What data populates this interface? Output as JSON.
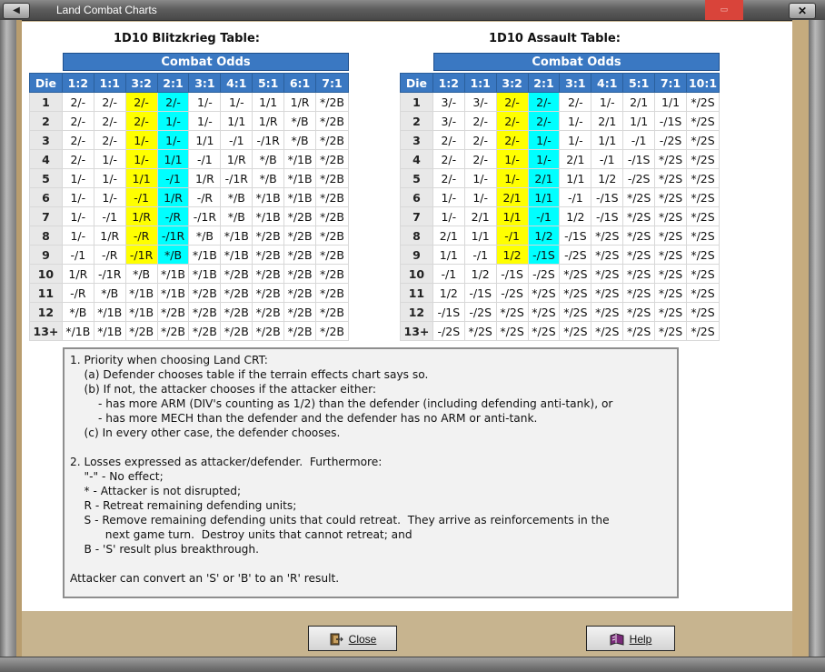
{
  "window": {
    "title": "Land Combat Charts",
    "left_icon": "◀",
    "minimize_icon": "▭",
    "close_icon": "✕"
  },
  "blitzkrieg": {
    "title": "1D10 Blitzkrieg Table:",
    "odds_banner": "Combat Odds",
    "headers": [
      "Die",
      "1:2",
      "1:1",
      "3:2",
      "2:1",
      "3:1",
      "4:1",
      "5:1",
      "6:1",
      "7:1"
    ],
    "rows": [
      [
        "1",
        "2/-",
        "2/-",
        "2/-",
        "2/-",
        "1/-",
        "1/-",
        "1/1",
        "1/R",
        "*/2B"
      ],
      [
        "2",
        "2/-",
        "2/-",
        "2/-",
        "1/-",
        "1/-",
        "1/1",
        "1/R",
        "*/B",
        "*/2B"
      ],
      [
        "3",
        "2/-",
        "2/-",
        "1/-",
        "1/-",
        "1/1",
        "-/1",
        "-/1R",
        "*/B",
        "*/2B"
      ],
      [
        "4",
        "2/-",
        "1/-",
        "1/-",
        "1/1",
        "-/1",
        "1/R",
        "*/B",
        "*/1B",
        "*/2B"
      ],
      [
        "5",
        "1/-",
        "1/-",
        "1/1",
        "-/1",
        "1/R",
        "-/1R",
        "*/B",
        "*/1B",
        "*/2B"
      ],
      [
        "6",
        "1/-",
        "1/-",
        "-/1",
        "1/R",
        "-/R",
        "*/B",
        "*/1B",
        "*/1B",
        "*/2B"
      ],
      [
        "7",
        "1/-",
        "-/1",
        "1/R",
        "-/R",
        "-/1R",
        "*/B",
        "*/1B",
        "*/2B",
        "*/2B"
      ],
      [
        "8",
        "1/-",
        "1/R",
        "-/R",
        "-/1R",
        "*/B",
        "*/1B",
        "*/2B",
        "*/2B",
        "*/2B"
      ],
      [
        "9",
        "-/1",
        "-/R",
        "-/1R",
        "*/B",
        "*/1B",
        "*/1B",
        "*/2B",
        "*/2B",
        "*/2B"
      ],
      [
        "10",
        "1/R",
        "-/1R",
        "*/B",
        "*/1B",
        "*/1B",
        "*/2B",
        "*/2B",
        "*/2B",
        "*/2B"
      ],
      [
        "11",
        "-/R",
        "*/B",
        "*/1B",
        "*/1B",
        "*/2B",
        "*/2B",
        "*/2B",
        "*/2B",
        "*/2B"
      ],
      [
        "12",
        "*/B",
        "*/1B",
        "*/1B",
        "*/2B",
        "*/2B",
        "*/2B",
        "*/2B",
        "*/2B",
        "*/2B"
      ],
      [
        "13+",
        "*/1B",
        "*/1B",
        "*/2B",
        "*/2B",
        "*/2B",
        "*/2B",
        "*/2B",
        "*/2B",
        "*/2B"
      ]
    ]
  },
  "assault": {
    "title": "1D10 Assault Table:",
    "odds_banner": "Combat Odds",
    "headers": [
      "Die",
      "1:2",
      "1:1",
      "3:2",
      "2:1",
      "3:1",
      "4:1",
      "5:1",
      "7:1",
      "10:1"
    ],
    "rows": [
      [
        "1",
        "3/-",
        "3/-",
        "2/-",
        "2/-",
        "2/-",
        "1/-",
        "2/1",
        "1/1",
        "*/2S"
      ],
      [
        "2",
        "3/-",
        "2/-",
        "2/-",
        "2/-",
        "1/-",
        "2/1",
        "1/1",
        "-/1S",
        "*/2S"
      ],
      [
        "3",
        "2/-",
        "2/-",
        "2/-",
        "1/-",
        "1/-",
        "1/1",
        "-/1",
        "-/2S",
        "*/2S"
      ],
      [
        "4",
        "2/-",
        "2/-",
        "1/-",
        "1/-",
        "2/1",
        "-/1",
        "-/1S",
        "*/2S",
        "*/2S"
      ],
      [
        "5",
        "2/-",
        "1/-",
        "1/-",
        "2/1",
        "1/1",
        "1/2",
        "-/2S",
        "*/2S",
        "*/2S"
      ],
      [
        "6",
        "1/-",
        "1/-",
        "2/1",
        "1/1",
        "-/1",
        "-/1S",
        "*/2S",
        "*/2S",
        "*/2S"
      ],
      [
        "7",
        "1/-",
        "2/1",
        "1/1",
        "-/1",
        "1/2",
        "-/1S",
        "*/2S",
        "*/2S",
        "*/2S"
      ],
      [
        "8",
        "2/1",
        "1/1",
        "-/1",
        "1/2",
        "-/1S",
        "*/2S",
        "*/2S",
        "*/2S",
        "*/2S"
      ],
      [
        "9",
        "1/1",
        "-/1",
        "1/2",
        "-/1S",
        "-/2S",
        "*/2S",
        "*/2S",
        "*/2S",
        "*/2S"
      ],
      [
        "10",
        "-/1",
        "1/2",
        "-/1S",
        "-/2S",
        "*/2S",
        "*/2S",
        "*/2S",
        "*/2S",
        "*/2S"
      ],
      [
        "11",
        "1/2",
        "-/1S",
        "-/2S",
        "*/2S",
        "*/2S",
        "*/2S",
        "*/2S",
        "*/2S",
        "*/2S"
      ],
      [
        "12",
        "-/1S",
        "-/2S",
        "*/2S",
        "*/2S",
        "*/2S",
        "*/2S",
        "*/2S",
        "*/2S",
        "*/2S"
      ],
      [
        "13+",
        "-/2S",
        "*/2S",
        "*/2S",
        "*/2S",
        "*/2S",
        "*/2S",
        "*/2S",
        "*/2S",
        "*/2S"
      ]
    ]
  },
  "highlight": {
    "yellow": "#ffff00",
    "cyan": "#00ffff",
    "header_blue": "#3a78c2"
  },
  "notes": [
    "1. Priority when choosing Land CRT:",
    "    (a) Defender chooses table if the terrain effects chart says so.",
    "    (b) If not, the attacker chooses if the attacker either:",
    "        - has more ARM (DIV's counting as 1/2) than the defender (including defending anti-tank), or",
    "        - has more MECH than the defender and the defender has no ARM or anti-tank.",
    "    (c) In every other case, the defender chooses.",
    "",
    "2. Losses expressed as attacker/defender.  Furthermore:",
    "    \"-\" - No effect;",
    "    * - Attacker is not disrupted;",
    "    R - Retreat remaining defending units;",
    "    S - Remove remaining defending units that could retreat.  They arrive as reinforcements in the",
    "          next game turn.  Destroy units that cannot retreat; and",
    "    B - 'S' result plus breakthrough.",
    "",
    "Attacker can convert an 'S' or 'B' to an 'R' result."
  ],
  "buttons": {
    "close_label": "Close",
    "help_label": "Help",
    "close_icon": "close-door-icon",
    "help_icon": "help-book-icon"
  }
}
